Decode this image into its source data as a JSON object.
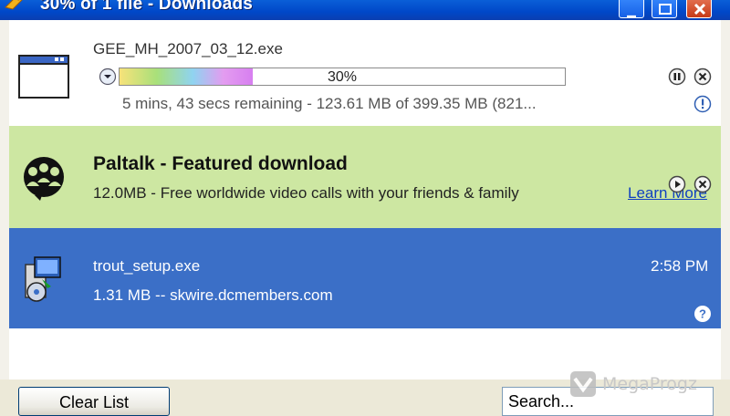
{
  "window": {
    "title": "30% of 1 file - Downloads"
  },
  "downloads": [
    {
      "filename": "GEE_MH_2007_03_12.exe",
      "progress_text": "30%",
      "progress": 0.3,
      "status": "5 mins, 43 secs remaining - 123.61 MB of 399.35 MB (821..."
    },
    {
      "title": "Paltalk - Featured download",
      "description": "12.0MB - Free worldwide video calls with your friends & family",
      "link": "Learn More"
    },
    {
      "filename": "trout_setup.exe",
      "meta": "1.31 MB -- skwire.dcmembers.com",
      "time": "2:58 PM"
    }
  ],
  "footer": {
    "clear_label": "Clear List",
    "search_placeholder": "Search..."
  },
  "watermark": "MegaProgz",
  "colors": {
    "titlebar": "#0047c8",
    "featured_bg": "#cde7a2",
    "selected_bg": "#3b6fc7",
    "link": "#1040c0"
  }
}
